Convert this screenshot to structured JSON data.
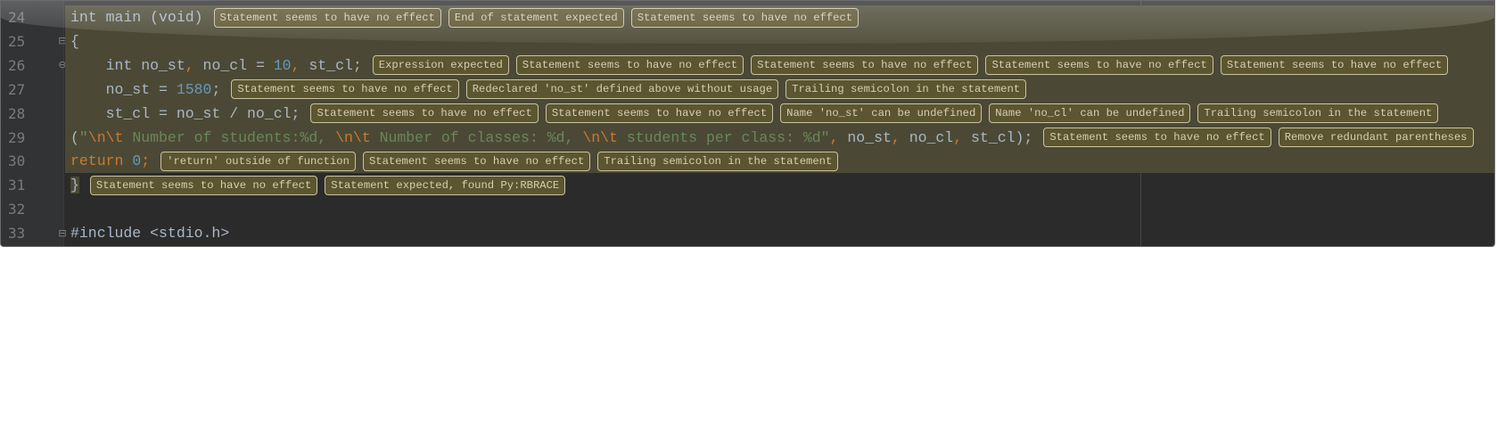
{
  "editor": {
    "lines": [
      {
        "number": "24",
        "highlight": true,
        "fold": "",
        "tokens": [
          {
            "text": "int main (void)",
            "cls": "plain"
          }
        ],
        "hints": [
          "Statement seems to have no effect",
          "End of statement expected",
          "Statement seems to have no effect"
        ]
      },
      {
        "number": "25",
        "highlight": true,
        "fold": "fold-open",
        "tokens": [
          {
            "text": "{",
            "cls": "plain"
          }
        ],
        "hints": []
      },
      {
        "number": "26",
        "highlight": true,
        "fold": "fold-close",
        "tokens": [
          {
            "text": "    int no_st",
            "cls": "plain"
          },
          {
            "text": ",",
            "cls": "punc"
          },
          {
            "text": " no_cl = ",
            "cls": "plain"
          },
          {
            "text": "10",
            "cls": "num"
          },
          {
            "text": ",",
            "cls": "punc"
          },
          {
            "text": " st_cl;",
            "cls": "plain"
          }
        ],
        "hints": [
          "Expression expected",
          "Statement seems to have no effect",
          "Statement seems to have no effect",
          "Statement seems to have no effect",
          "Statement seems to have no effect"
        ]
      },
      {
        "number": "27",
        "highlight": true,
        "fold": "",
        "tokens": [
          {
            "text": "    no_st = ",
            "cls": "plain"
          },
          {
            "text": "1580",
            "cls": "num"
          },
          {
            "text": ";",
            "cls": "plain"
          }
        ],
        "hints": [
          "Statement seems to have no effect",
          "Redeclared 'no_st' defined above without usage",
          "Trailing semicolon in the statement"
        ]
      },
      {
        "number": "28",
        "highlight": true,
        "fold": "",
        "tokens": [
          {
            "text": "    st_cl = no_st / no_cl;",
            "cls": "plain"
          }
        ],
        "hints": [
          "Statement seems to have no effect",
          "Statement seems to have no effect",
          "Name 'no_st' can be undefined",
          "Name 'no_cl' can be undefined",
          "Trailing semicolon in the statement"
        ]
      },
      {
        "number": "29",
        "highlight": true,
        "fold": "",
        "tokens": [
          {
            "text": "(",
            "cls": "plain"
          },
          {
            "text": "\"",
            "cls": "str"
          },
          {
            "text": "\\n\\t",
            "cls": "esc"
          },
          {
            "text": " Number of students:%d, ",
            "cls": "str"
          },
          {
            "text": "\\n\\t",
            "cls": "esc"
          },
          {
            "text": " Number of classes: %d, ",
            "cls": "str"
          },
          {
            "text": "\\n\\t",
            "cls": "esc"
          },
          {
            "text": " students per class: %d\"",
            "cls": "str"
          },
          {
            "text": ",",
            "cls": "punc"
          },
          {
            "text": " no_st",
            "cls": "plain"
          },
          {
            "text": ",",
            "cls": "punc"
          },
          {
            "text": " no_cl",
            "cls": "plain"
          },
          {
            "text": ",",
            "cls": "punc"
          },
          {
            "text": " st_cl);",
            "cls": "plain"
          }
        ],
        "hints": [
          "Statement seems to have no effect",
          "Remove redundant parentheses"
        ]
      },
      {
        "number": "30",
        "highlight": true,
        "fold": "",
        "tokens": [
          {
            "text": "return",
            "cls": "kw"
          },
          {
            "text": " ",
            "cls": "plain"
          },
          {
            "text": "0",
            "cls": "num"
          },
          {
            "text": ";",
            "cls": "punc"
          }
        ],
        "hints": [
          "'return' outside of function",
          "Statement seems to have no effect",
          "Trailing semicolon in the statement"
        ]
      },
      {
        "number": "31",
        "highlight": false,
        "fold": "",
        "tokens": [
          {
            "text": "}",
            "cls": "plain"
          }
        ],
        "hints": [
          "Statement seems to have no effect",
          "Statement expected, found Py:RBRACE"
        ]
      },
      {
        "number": "32",
        "highlight": false,
        "fold": "",
        "tokens": [],
        "hints": []
      },
      {
        "number": "33",
        "highlight": false,
        "fold": "fold-open",
        "tokens": [
          {
            "text": "#include <stdio.h>",
            "cls": "plain"
          }
        ],
        "hints": []
      }
    ]
  }
}
